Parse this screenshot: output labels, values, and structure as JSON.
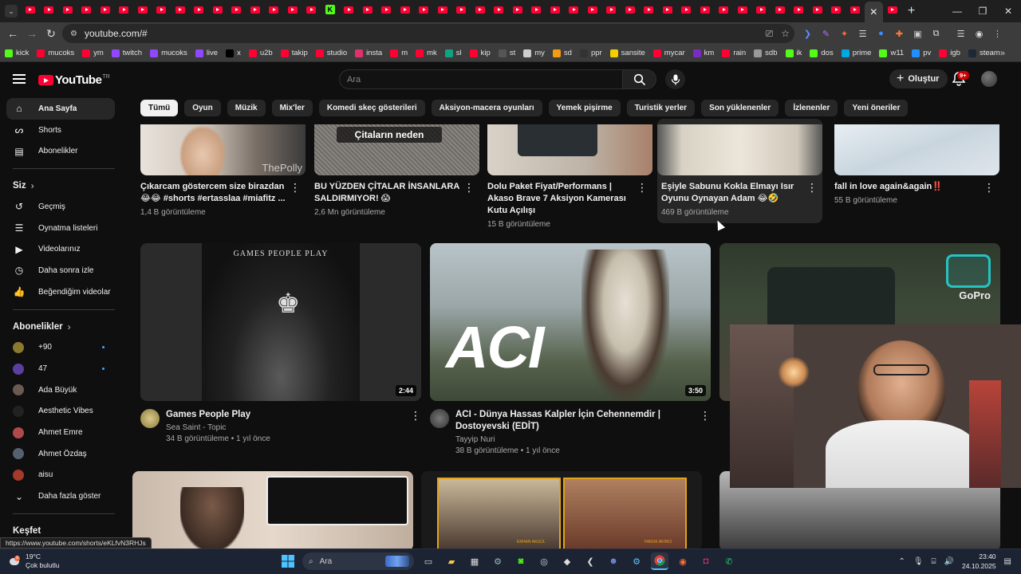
{
  "browser": {
    "url": "youtube.com/#",
    "status_url": "https://www.youtube.com/shorts/eKLfvN3RHJs",
    "bookmarks": [
      {
        "label": "kick",
        "color": "#53fc18"
      },
      {
        "label": "mucoks",
        "color": "#ff0033"
      },
      {
        "label": "ym",
        "color": "#ff0033"
      },
      {
        "label": "twitch",
        "color": "#9146ff"
      },
      {
        "label": "mucoks",
        "color": "#9146ff"
      },
      {
        "label": "live",
        "color": "#9146ff"
      },
      {
        "label": "x",
        "color": "#000000"
      },
      {
        "label": "u2b",
        "color": "#ff0033"
      },
      {
        "label": "takip",
        "color": "#ff0033"
      },
      {
        "label": "studio",
        "color": "#ff0033"
      },
      {
        "label": "insta",
        "color": "#e1306c"
      },
      {
        "label": "m",
        "color": "#ff0033"
      },
      {
        "label": "mk",
        "color": "#ff0033"
      },
      {
        "label": "sl",
        "color": "#0fa37f"
      },
      {
        "label": "kip",
        "color": "#ff0033"
      },
      {
        "label": "st",
        "color": "#555555"
      },
      {
        "label": "my",
        "color": "#cccccc"
      },
      {
        "label": "sd",
        "color": "#f39c12"
      },
      {
        "label": "ppr",
        "color": "#333333"
      },
      {
        "label": "sansite",
        "color": "#f5d000"
      },
      {
        "label": "mycar",
        "color": "#ff0033"
      },
      {
        "label": "km",
        "color": "#7b2cbf"
      },
      {
        "label": "rain",
        "color": "#ff0033"
      },
      {
        "label": "sdb",
        "color": "#999999"
      },
      {
        "label": "ik",
        "color": "#53fc18"
      },
      {
        "label": "dos",
        "color": "#53fc18"
      },
      {
        "label": "prime",
        "color": "#00a8e1"
      },
      {
        "label": "w11",
        "color": "#53fc18"
      },
      {
        "label": "pv",
        "color": "#1e90ff"
      },
      {
        "label": "igb",
        "color": "#ff0033"
      },
      {
        "label": "steam",
        "color": "#1b2838"
      }
    ]
  },
  "masthead": {
    "logo_text": "YouTube",
    "logo_country": "TR",
    "search_placeholder": "Ara",
    "create_label": "Oluştur",
    "notifications_badge": "9+"
  },
  "chips": [
    "Tümü",
    "Oyun",
    "Müzik",
    "Mix'ler",
    "Komedi skeç gösterileri",
    "Aksiyon-macera oyunları",
    "Yemek pişirme",
    "Turistik yerler",
    "Son yüklenenler",
    "İzlenenler",
    "Yeni öneriler"
  ],
  "sidebar": {
    "main": [
      {
        "label": "Ana Sayfa",
        "icon": "home-icon"
      },
      {
        "label": "Shorts",
        "icon": "shorts-icon"
      },
      {
        "label": "Abonelikler",
        "icon": "subscriptions-icon"
      }
    ],
    "you_header": "Siz",
    "you": [
      {
        "label": "Geçmiş",
        "icon": "history-icon"
      },
      {
        "label": "Oynatma listeleri",
        "icon": "playlists-icon"
      },
      {
        "label": "Videolarınız",
        "icon": "your-videos-icon"
      },
      {
        "label": "Daha sonra izle",
        "icon": "watch-later-icon"
      },
      {
        "label": "Beğendiğim videolar",
        "icon": "liked-icon"
      }
    ],
    "subs_header": "Abonelikler",
    "subs": [
      {
        "label": "+90",
        "color": "#8b7a2e",
        "live": true
      },
      {
        "label": "47",
        "color": "#5b3fa0",
        "live": true
      },
      {
        "label": "Ada Büyük",
        "color": "#6a5a50",
        "live": false
      },
      {
        "label": "Aesthetic Vibes",
        "color": "#222222",
        "live": false
      },
      {
        "label": "Ahmet Emre",
        "color": "#b04a4a",
        "live": false
      },
      {
        "label": "Ahmet Özdaş",
        "color": "#556070",
        "live": false
      },
      {
        "label": "aisu",
        "color": "#a33a2a",
        "live": false
      }
    ],
    "show_more": "Daha fazla göster",
    "explore_header": "Keşfet"
  },
  "shorts_row": [
    {
      "title": "Çıkarcam göstercem size birazdan😂😂 #shorts #ertasslaa #miafitz ...",
      "views": "1,4 B görüntüleme",
      "thumb_text": "ThePolly"
    },
    {
      "title": "BU YÜZDEN ÇİTALAR İNSANLARA SALDIRMIYOR! 😱",
      "views": "2,6 Mn görüntüleme",
      "thumb_text": "Çitaların neden"
    },
    {
      "title": "Dolu Paket Fiyat/Performans | Akaso Brave 7 Aksiyon Kamerası Kutu Açılışı",
      "views": "15 B görüntüleme",
      "thumb_text": ""
    },
    {
      "title": "Eşiyle Sabunu Kokla Elmayı Isır Oyunu Oynayan Adam 😂🤣",
      "views": "469 B görüntüleme",
      "thumb_text": ""
    },
    {
      "title": "fall in love again&again‼️",
      "views": "55 B görüntüleme",
      "thumb_text": ""
    }
  ],
  "videos_row": [
    {
      "title": "Games People Play",
      "channel": "Sea Saint - Topic",
      "meta": "34 B görüntüleme • 1 yıl önce",
      "duration": "2:44",
      "thumb_title": "GAMES PEOPLE PLAY"
    },
    {
      "title": "ACI - Dünya Hassas Kalpler İçin Cehennemdir | Dostoyevski (EDİT)",
      "channel": "Tayyip Nuri",
      "meta": "38 B görüntüleme • 1 yıl önce",
      "duration": "3:50",
      "thumb_title": "ACI"
    },
    {
      "title": "",
      "channel": "",
      "meta": "",
      "duration": "",
      "thumb_title": "GoPro"
    }
  ],
  "row3": {
    "stream_labels": [
      "ERHAN AKGÜL",
      "FARUK AKINCI"
    ]
  },
  "taskbar": {
    "temperature": "19°C",
    "weather": "Çok bulutlu",
    "search": "Ara",
    "time": "23:40",
    "date": "24.10.2025"
  }
}
